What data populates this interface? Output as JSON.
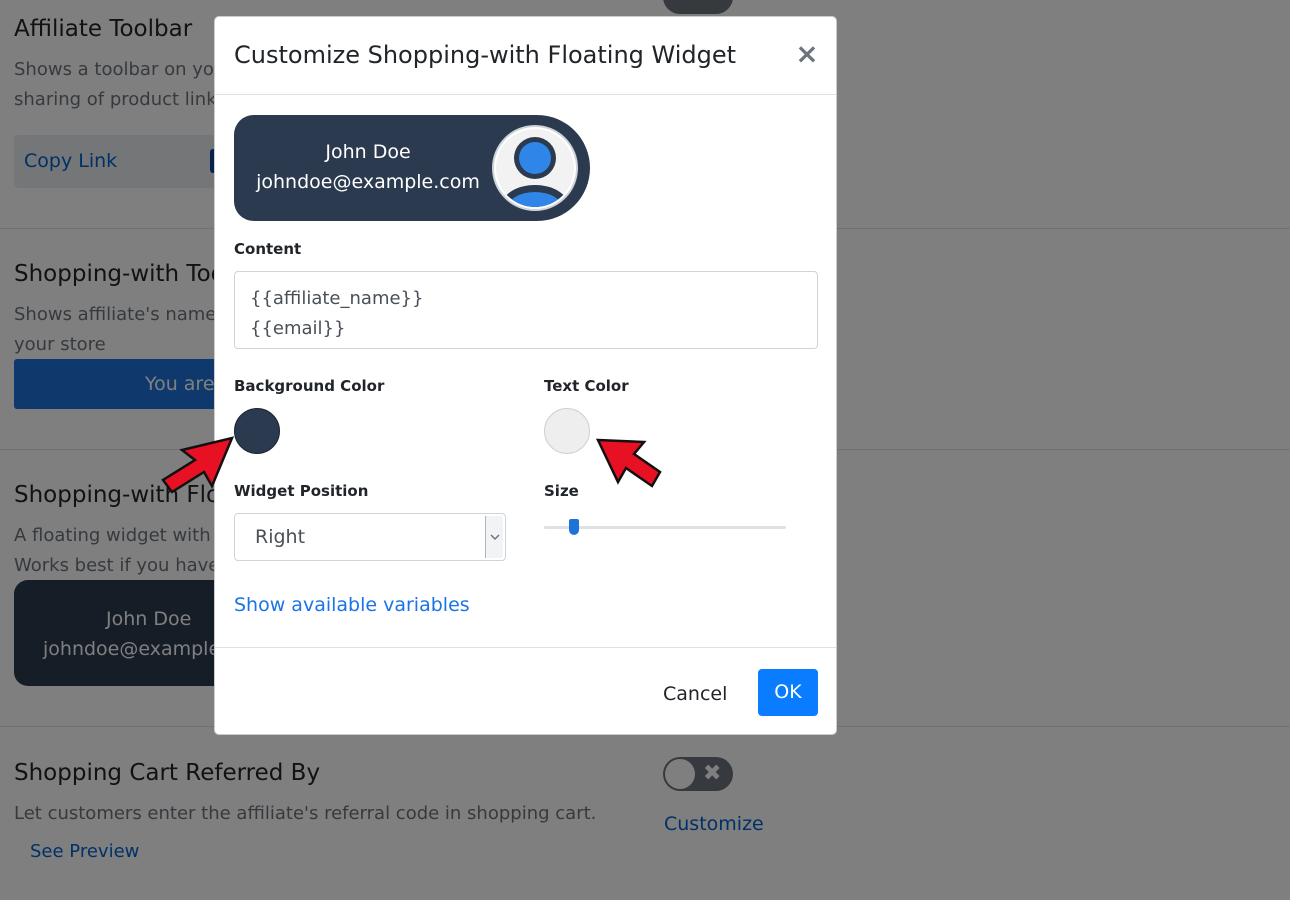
{
  "background": {
    "sections": [
      {
        "title": "Affiliate Toolbar",
        "desc_lines": [
          "Shows a toolbar on you",
          "sharing of product link"
        ],
        "copy_link_label": "Copy Link"
      },
      {
        "title": "Shopping-with Too",
        "desc_lines": [
          "Shows affiliate's name",
          "your store"
        ],
        "bar_text": "You are"
      },
      {
        "title": "Shopping-with Flo",
        "desc_lines": [
          "A floating widget with",
          "Works best if you have"
        ],
        "widget_name": "John Doe",
        "widget_email": "johndoe@example."
      },
      {
        "title": "Shopping Cart Referred By",
        "desc_lines": [
          "Let customers enter the affiliate's referral code in shopping cart."
        ],
        "see_preview": "See Preview",
        "customize": "Customize",
        "toggle_icon": "✖"
      }
    ]
  },
  "modal": {
    "title": "Customize Shopping-with Floating Widget",
    "close_glyph": "×",
    "preview": {
      "name": "John Doe",
      "email": "johndoe@example.com",
      "avatar_icon": "user-avatar-icon"
    },
    "content_label": "Content",
    "content_lines": [
      "{{affiliate_name}}",
      "{{email}}"
    ],
    "background_color_label": "Background Color",
    "background_color": "#2b3a4f",
    "text_color_label": "Text Color",
    "text_color": "#eeeeee",
    "widget_position_label": "Widget Position",
    "widget_position_value": "Right",
    "size_label": "Size",
    "size_value_fraction": 0.1,
    "show_variables_link": "Show available variables",
    "cancel_label": "Cancel",
    "ok_label": "OK"
  },
  "colors": {
    "accent": "#0a7cff",
    "widget_bg": "#2b3a4f",
    "annotation_arrow": "#e81123"
  }
}
